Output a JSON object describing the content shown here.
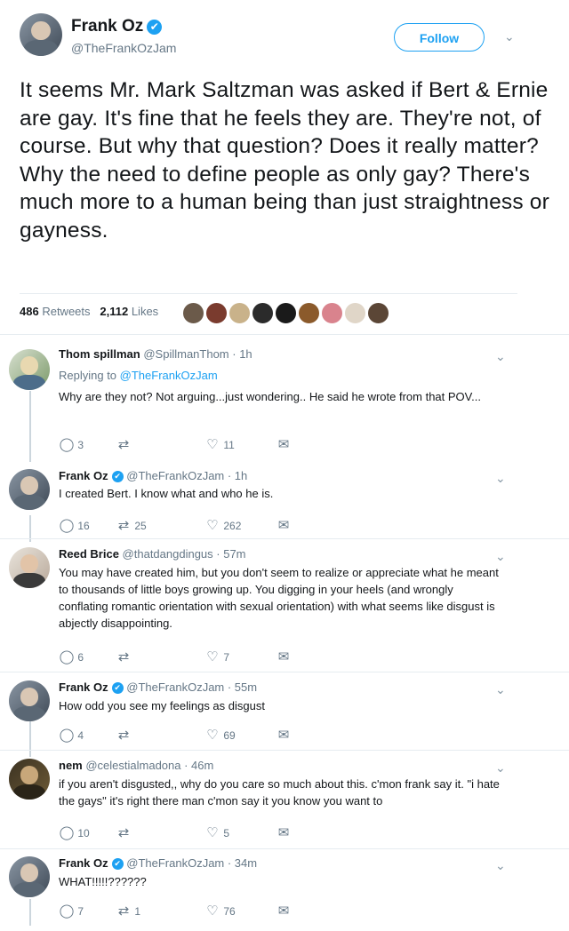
{
  "tweet": {
    "author_name": "Frank Oz",
    "handle": "@TheFrankOzJam",
    "follow_label": "Follow",
    "text": "It seems Mr. Mark Saltzman was asked if Bert & Ernie are gay. It's fine that he feels they are. They're not, of course. But why that question? Does it really matter? Why the need to define people as only gay? There's much more to a human being than just straightness or gayness.",
    "retweets_count": "486",
    "retweets_label": "Retweets",
    "likes_count": "2,112",
    "likes_label": "Likes"
  },
  "replies": [
    {
      "name": "Thom spillman",
      "handle": "@SpillmanThom · 1h",
      "replying_prefix": "Replying to ",
      "replying_to": "@TheFrankOzJam",
      "text": "Why are they not?  Not arguing...just wondering..  He said he wrote from that POV...",
      "reply_count": "3",
      "retweet_count": "",
      "like_count": "11"
    },
    {
      "name": "Frank Oz",
      "handle": "@TheFrankOzJam · 1h",
      "text": "I created Bert. I know what and who he is.",
      "reply_count": "16",
      "retweet_count": "25",
      "like_count": "262"
    },
    {
      "name": "Reed Brice",
      "handle": "@thatdangdingus · 57m",
      "text": "You may have created him, but you don't seem to realize or appreciate what he meant to thousands of little boys growing up. You digging in your heels (and wrongly conflating romantic orientation with sexual orientation) with what seems like disgust is abjectly disappointing.",
      "reply_count": "6",
      "retweet_count": "",
      "like_count": "7"
    },
    {
      "name": "Frank Oz",
      "handle": "@TheFrankOzJam · 55m",
      "text": "How odd you see my feelings as disgust",
      "reply_count": "4",
      "retweet_count": "",
      "like_count": "69"
    },
    {
      "name": "nem",
      "handle": "@celestialmadona · 46m",
      "text": "if you aren't disgusted,, why do you care so much about this. c'mon frank say it. \"i hate the gays\" it's right there man c'mon say it you know you want to",
      "reply_count": "10",
      "retweet_count": "",
      "like_count": "5"
    },
    {
      "name": "Frank Oz",
      "handle": "@TheFrankOzJam · 34m",
      "text": "WHAT!!!!!??????",
      "reply_count": "7",
      "retweet_count": "1",
      "like_count": "76"
    }
  ],
  "icons": {
    "verified": "✔",
    "chevron": "⌄",
    "reply": "◯",
    "retweet": "⇄",
    "like": "♡",
    "message": "✉"
  },
  "colors": {
    "accent": "#1da1f2",
    "muted": "#657786",
    "text": "#14171a",
    "divider": "#e6ecf0"
  }
}
